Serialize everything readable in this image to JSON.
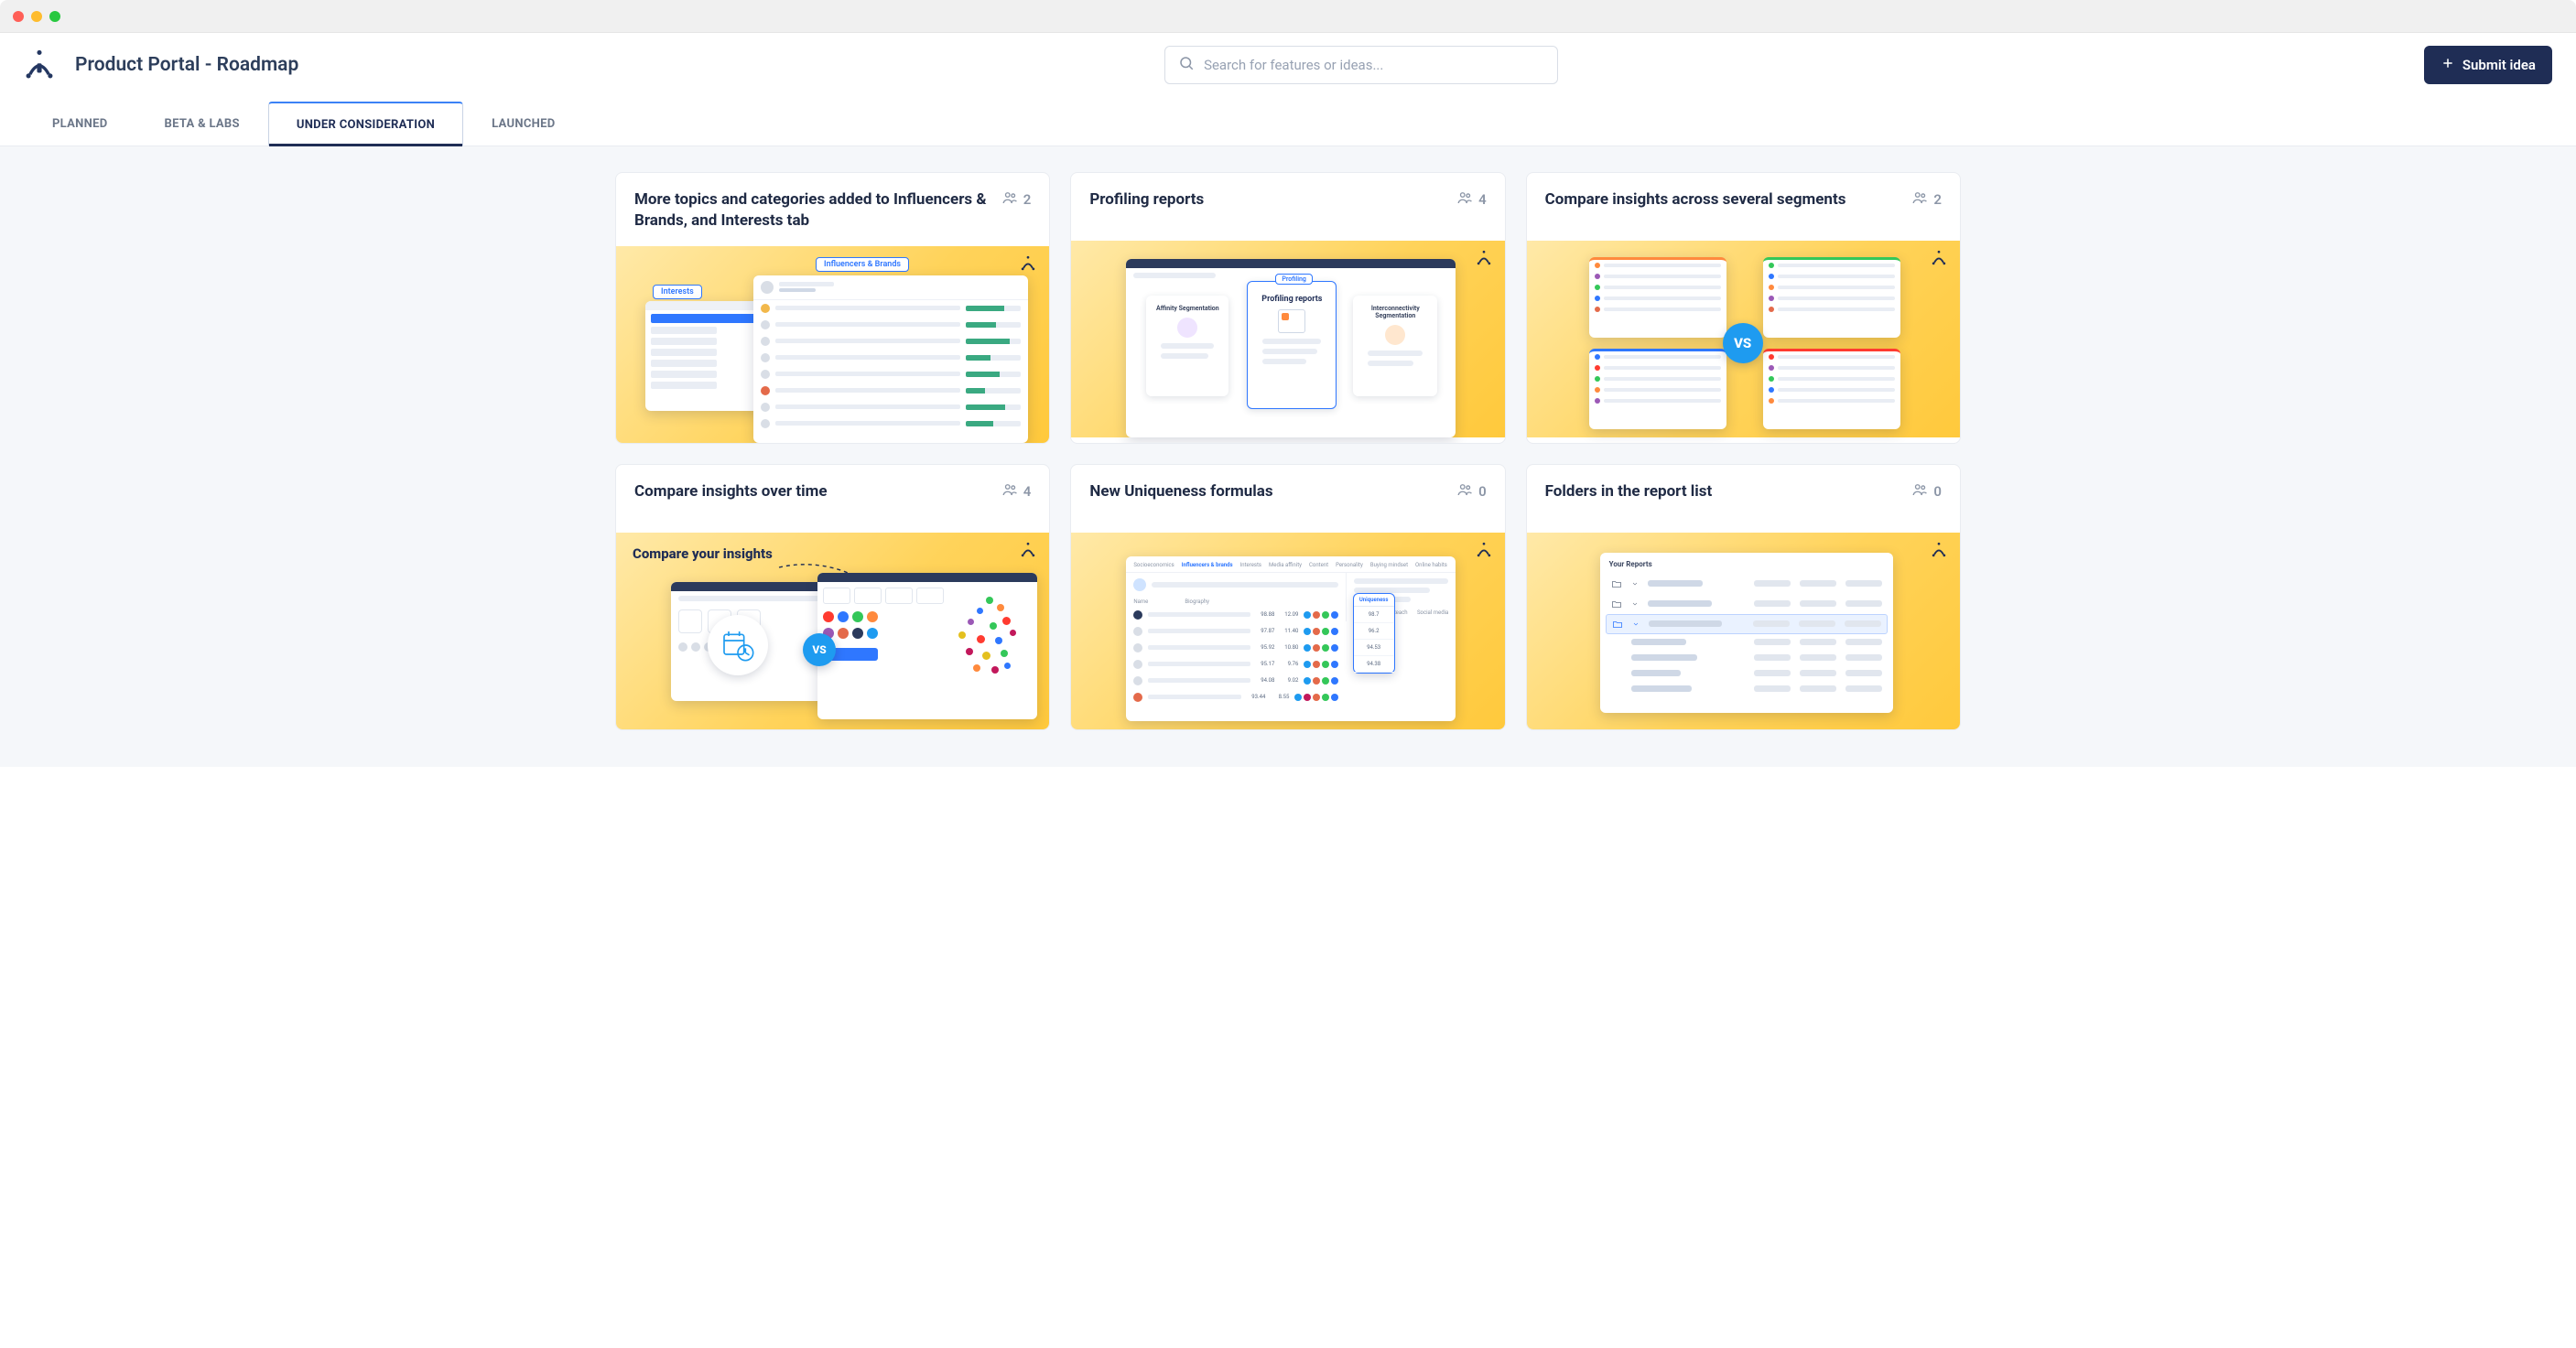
{
  "page_title": "Product Portal - Roadmap",
  "search": {
    "placeholder": "Search for features or ideas..."
  },
  "submit_label": "Submit idea",
  "tabs": [
    {
      "label": "PLANNED",
      "active": false
    },
    {
      "label": "BETA & LABS",
      "active": false
    },
    {
      "label": "UNDER CONSIDERATION",
      "active": true
    },
    {
      "label": "LAUNCHED",
      "active": false
    }
  ],
  "cards": [
    {
      "title": "More topics and categories added to Influencers & Brands, and Interests tab",
      "votes": "2",
      "pills": {
        "a": "Interests",
        "b": "Influencers & Brands"
      }
    },
    {
      "title": "Profiling reports",
      "votes": "4",
      "sub2_title": "Profiling reports",
      "sub2_pill": "Profiling",
      "sub1_title": "Affinity Segmentation",
      "sub3_title": "Interconnectivity Segmentation"
    },
    {
      "title": "Compare insights across several segments",
      "votes": "2",
      "vs_label": "VS"
    },
    {
      "title": "Compare insights over time",
      "votes": "4",
      "headline": "Compare your insights",
      "vs_label": "VS"
    },
    {
      "title": "New Uniqueness formulas",
      "votes": "0",
      "popup_header": "Uniqueness",
      "popup_values": [
        "98.7",
        "96.2",
        "94.53",
        "94.38"
      ]
    },
    {
      "title": "Folders in the report list",
      "votes": "0",
      "panel_header": "Your Reports"
    }
  ]
}
